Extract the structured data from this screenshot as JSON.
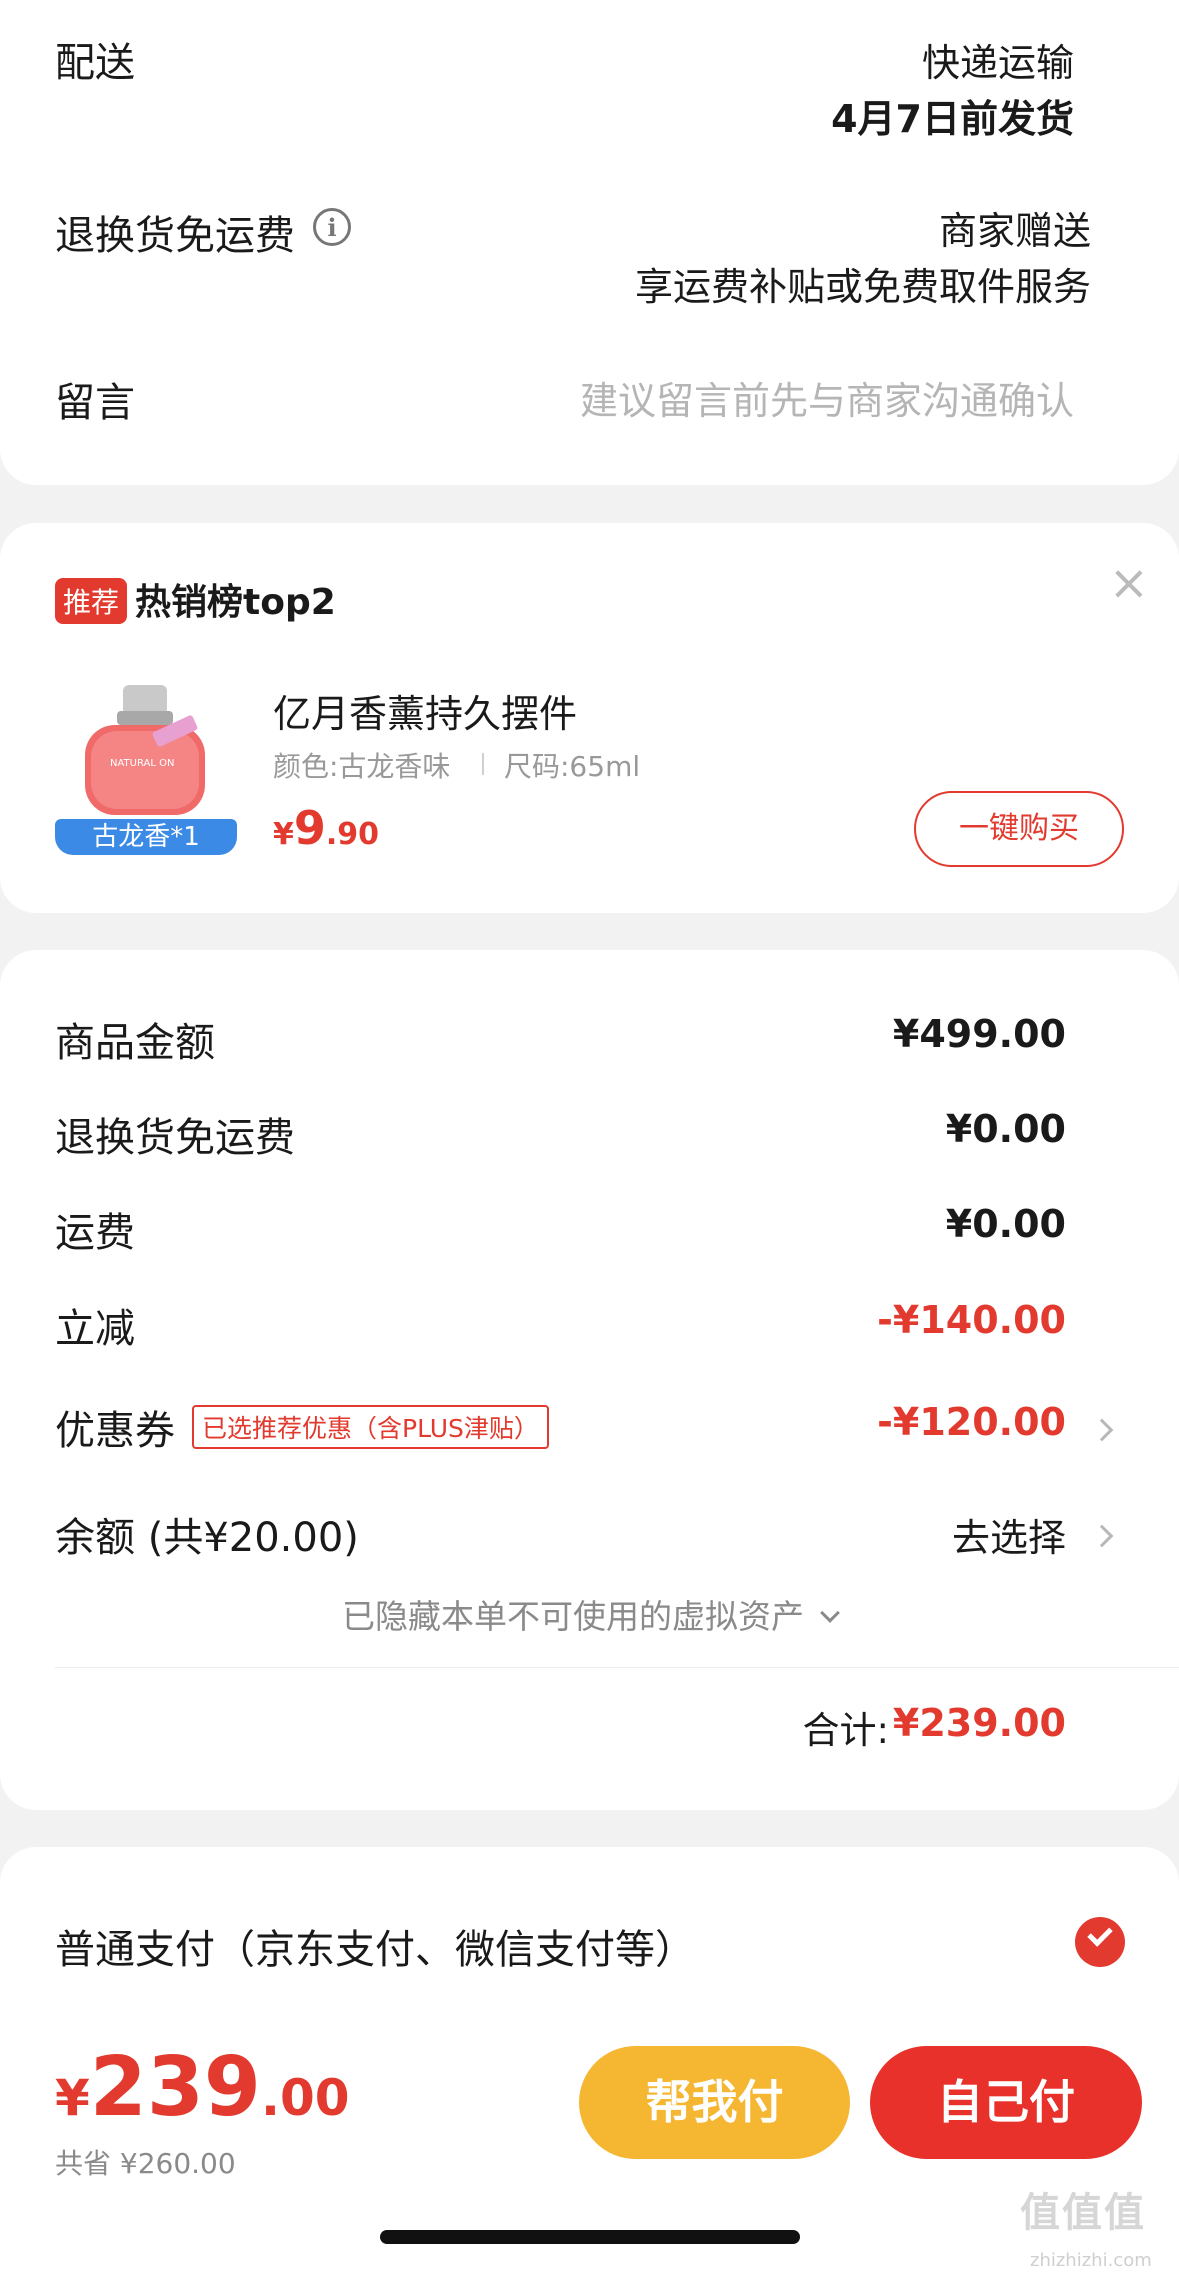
{
  "delivery": {
    "label": "配送",
    "method": "快递运输",
    "ship_date": "4月7日前发货",
    "return_label": "退换货免运费",
    "return_value_line1": "商家赠送",
    "return_value_line2": "享运费补贴或免费取件服务",
    "message_label": "留言",
    "message_placeholder": "建议留言前先与商家沟通确认"
  },
  "recommend": {
    "tag": "推荐",
    "title": "热销榜top2",
    "product_name": "亿月香薰持久摆件",
    "color_spec": "颜色:古龙香味",
    "size_spec": "尺码:65ml",
    "price_symbol": "¥",
    "price_int": "9",
    "price_dec": ".90",
    "badge": "古龙香*1",
    "buy_label": "一键购买",
    "bottle_text": "NATURAL ON"
  },
  "summary": {
    "goods_label": "商品金额",
    "goods_value": "¥499.00",
    "return_label": "退换货免运费",
    "return_value": "¥0.00",
    "freight_label": "运费",
    "freight_value": "¥0.00",
    "discount_label": "立减",
    "discount_value": "-¥140.00",
    "coupon_label": "优惠券",
    "coupon_tag": "已选推荐优惠（含PLUS津贴）",
    "coupon_value": "-¥120.00",
    "balance_label": "余额 (共¥20.00)",
    "balance_action": "去选择",
    "hidden_assets": "已隐藏本单不可使用的虚拟资产",
    "total_label": "合计:",
    "total_value": "¥239.00"
  },
  "payment": {
    "method": "普通支付（京东支付、微信支付等）"
  },
  "bottom": {
    "currency": "¥",
    "amount_int": "239",
    "amount_dec": ".00",
    "saved": "共省 ¥260.00",
    "help_pay": "帮我付",
    "self_pay": "自己付"
  },
  "watermark": "值值值",
  "watermark_url": "zhizhizhi.com",
  "colors": {
    "accent_red": "#e23a2e",
    "help_pay_yellow": "#f5b632",
    "coupon_tag_border": "#e23a2e"
  }
}
